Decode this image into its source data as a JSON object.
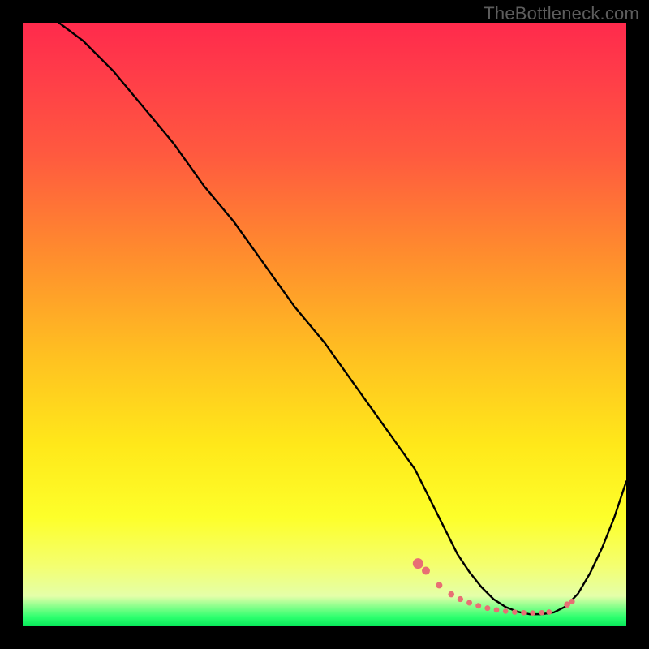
{
  "watermark": "TheBottleneck.com",
  "chart_data": {
    "type": "line",
    "title": "",
    "xlabel": "",
    "ylabel": "",
    "xlim": [
      0,
      100
    ],
    "ylim": [
      0,
      100
    ],
    "grid": false,
    "legend": false,
    "series": [
      {
        "name": "curve",
        "color": "#000000",
        "x": [
          6,
          10,
          15,
          20,
          25,
          30,
          35,
          40,
          45,
          50,
          55,
          60,
          65,
          68,
          70,
          72,
          74,
          76,
          78,
          80,
          82,
          84,
          86,
          88,
          90,
          92,
          94,
          96,
          98,
          100
        ],
        "y": [
          100,
          97,
          92,
          86,
          80,
          73,
          67,
          60,
          53,
          47,
          40,
          33,
          26,
          20,
          16,
          12,
          9,
          6.5,
          4.5,
          3.2,
          2.4,
          2.0,
          2.0,
          2.3,
          3.3,
          5.4,
          8.8,
          13.0,
          18.0,
          24.0
        ]
      }
    ],
    "marker_points": {
      "color": "#e86f74",
      "x": [
        65.5,
        66.8,
        69.0,
        71.0,
        72.5,
        74.0,
        75.5,
        77.0,
        78.5,
        80.0,
        81.5,
        83.0,
        84.5,
        86.0,
        87.2,
        90.2,
        91.0
      ],
      "y": [
        10.4,
        9.2,
        6.8,
        5.3,
        4.5,
        3.9,
        3.4,
        3.0,
        2.7,
        2.5,
        2.35,
        2.25,
        2.2,
        2.25,
        2.35,
        3.6,
        4.1
      ],
      "r": [
        6.5,
        5.0,
        4.0,
        3.8,
        3.6,
        3.5,
        3.5,
        3.5,
        3.4,
        3.3,
        3.3,
        3.3,
        3.3,
        3.3,
        3.4,
        3.8,
        3.6
      ]
    },
    "background_gradient_stops": [
      {
        "pos": 0.0,
        "color": "#ff2a4c"
      },
      {
        "pos": 0.22,
        "color": "#ff5a3f"
      },
      {
        "pos": 0.55,
        "color": "#ffc021"
      },
      {
        "pos": 0.82,
        "color": "#fdff2a"
      },
      {
        "pos": 0.985,
        "color": "#2cff6e"
      },
      {
        "pos": 1.0,
        "color": "#08e85a"
      }
    ]
  }
}
